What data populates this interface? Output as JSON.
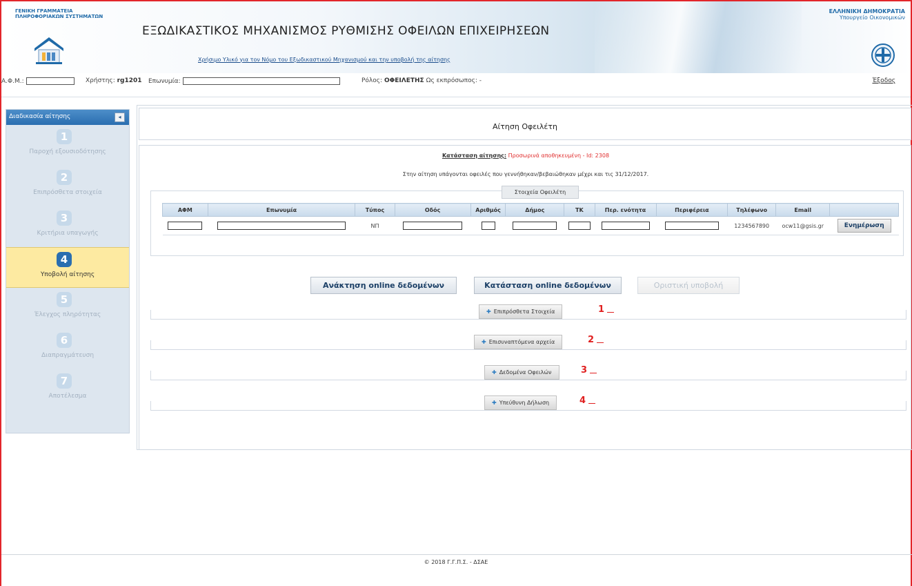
{
  "header": {
    "gsis_line1": "ΓΕΝΙΚΗ ΓΡΑΜΜΑΤΕΙΑ",
    "gsis_line2": "ΠΛΗΡΟΦΟΡΙΑΚΩΝ ΣΥΣΤΗΜΑΤΩΝ",
    "title": "ΕΞΩΔΙΚΑΣΤΙΚΟΣ ΜΗΧΑΝΙΣΜΟΣ ΡΥΘΜΙΣΗΣ ΟΦΕΙΛΩΝ ΕΠΙΧΕΙΡΗΣΕΩΝ",
    "useful_link": "Χρήσιμο Υλικό για τον Νόμο του Εξωδικαστικού Μηχανισμού και την υποβολή της αίτησης",
    "gov_line1": "ΕΛΛΗΝΙΚΗ ΔΗΜΟΚΡΑΤΙΑ",
    "gov_line2": "Υπουργείο Οικονομικών"
  },
  "userbar": {
    "afm_label": "Α.Φ.Μ.:",
    "user_label": "Χρήστης:",
    "user_value": "rg1201",
    "name_label": "Επωνυμία:",
    "role_label": "Ρόλος:",
    "role_value": "ΟΦΕΙΛΕΤΗΣ",
    "rep_label": "Ως εκπρόσωπος:",
    "rep_value": "-",
    "logout": "Έξοδος"
  },
  "sidebar": {
    "title": "Διαδικασία αίτησης",
    "collapse_icon": "◂",
    "steps": [
      {
        "num": "1",
        "label": "Παροχή εξουσιοδότησης"
      },
      {
        "num": "2",
        "label": "Επιπρόσθετα στοιχεία"
      },
      {
        "num": "3",
        "label": "Κριτήρια υπαγωγής"
      },
      {
        "num": "4",
        "label": "Υποβολή αίτησης"
      },
      {
        "num": "5",
        "label": "Έλεγχος πληρότητας"
      },
      {
        "num": "6",
        "label": "Διαπραγμάτευση"
      },
      {
        "num": "7",
        "label": "Αποτέλεσμα"
      }
    ],
    "active_step": 4
  },
  "main": {
    "page_title": "Αίτηση Οφειλέτη",
    "status_label": "Κατάσταση αίτησης:",
    "status_value": "Προσωρινά αποθηκευμένη - Id: 2308",
    "info_text": "Στην αίτηση υπάγονται οφειλές που γεννήθηκαν/βεβαιώθηκαν μέχρι και τις 31/12/2017.",
    "debtor_tab": "Στοιχεία Οφειλέτη",
    "table": {
      "headers": [
        "ΑΦΜ",
        "Επωνυμία",
        "Τύπος",
        "Οδός",
        "Αριθμός",
        "Δήμος",
        "ΤΚ",
        "Περ. ενότητα",
        "Περιφέρεια",
        "Τηλέφωνο",
        "Email",
        ""
      ],
      "row": {
        "type": "ΝΠ",
        "phone": "1234567890",
        "email": "ocw11@gsis.gr",
        "update_button": "Ενημέρωση"
      }
    },
    "buttons": {
      "fetch": "Ανάκτηση online δεδομένων",
      "status": "Κατάσταση online δεδομένων",
      "submit": "Οριστική υποβολή"
    },
    "sections": [
      {
        "label": "Επιπρόσθετα Στοιχεία",
        "annotation": "1"
      },
      {
        "label": "Επισυναπτόμενα αρχεία",
        "annotation": "2"
      },
      {
        "label": "Δεδομένα Οφειλών",
        "annotation": "3"
      },
      {
        "label": "Υπεύθυνη Δήλωση",
        "annotation": "4"
      }
    ],
    "plus_icon": "✚"
  },
  "footer": {
    "text": "© 2018 Γ.Γ.Π.Σ. - ΔΣΑΕ"
  },
  "colors": {
    "accent": "#2a6eb0",
    "active_step_bg": "#fdeaa1",
    "annotation": "#e02020",
    "status_value": "#e02e2e",
    "frame": "#e2262b"
  }
}
